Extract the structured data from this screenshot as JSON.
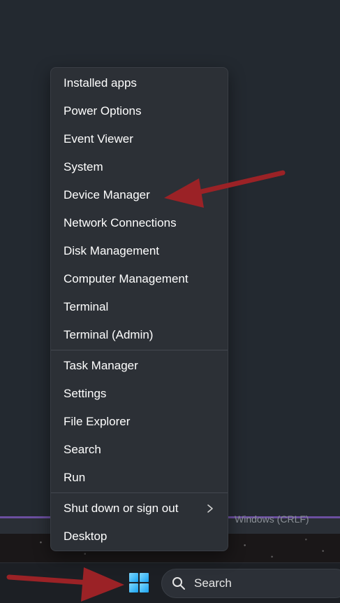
{
  "context_menu": {
    "group1": [
      {
        "id": "installed-apps",
        "label": "Installed apps"
      },
      {
        "id": "power-options",
        "label": "Power Options"
      },
      {
        "id": "event-viewer",
        "label": "Event Viewer"
      },
      {
        "id": "system",
        "label": "System"
      },
      {
        "id": "device-manager",
        "label": "Device Manager"
      },
      {
        "id": "network-connections",
        "label": "Network Connections"
      },
      {
        "id": "disk-management",
        "label": "Disk Management"
      },
      {
        "id": "computer-management",
        "label": "Computer Management"
      },
      {
        "id": "terminal",
        "label": "Terminal"
      },
      {
        "id": "terminal-admin",
        "label": "Terminal (Admin)"
      }
    ],
    "group2": [
      {
        "id": "task-manager",
        "label": "Task Manager"
      },
      {
        "id": "settings",
        "label": "Settings"
      },
      {
        "id": "file-explorer",
        "label": "File Explorer"
      },
      {
        "id": "search",
        "label": "Search"
      },
      {
        "id": "run",
        "label": "Run"
      }
    ],
    "group3": [
      {
        "id": "shut-down",
        "label": "Shut down or sign out",
        "has_submenu": true
      },
      {
        "id": "desktop",
        "label": "Desktop"
      }
    ]
  },
  "editor": {
    "line_ending_status": "Windows (CRLF)"
  },
  "taskbar": {
    "start_icon": "windows-logo-icon",
    "search_placeholder": "Search",
    "search_icon": "search-icon"
  },
  "annotations": {
    "arrow_color": "#9b2226"
  },
  "colors": {
    "menu_bg": "#2c3036",
    "desktop_bg": "#232930",
    "taskbar_bg": "#1c1f24",
    "accent_blue": "#1aa3f0"
  }
}
